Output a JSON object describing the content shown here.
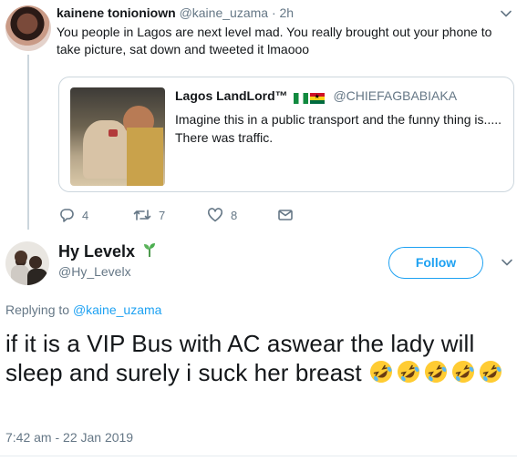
{
  "parent_tweet": {
    "display_name": "kainene tonioniown",
    "handle": "@kaine_uzama",
    "separator": "·",
    "timestamp": "2h",
    "text": "You people in Lagos are next level mad. You really brought out your phone to take picture, sat down and tweeted it lmaooo",
    "quoted_tweet": {
      "display_name": "Lagos LandLord™",
      "flags": [
        "nigeria-flag",
        "ghana-flag"
      ],
      "handle": "@CHIEFAGBABIAKA",
      "text": "Imagine this in a public transport and the funny thing is..... There was traffic."
    },
    "actions": {
      "reply_count": "4",
      "retweet_count": "7",
      "like_count": "8",
      "icons": [
        "reply-icon",
        "retweet-icon",
        "like-icon",
        "message-icon"
      ]
    }
  },
  "reply_tweet": {
    "display_name": "Hy Levelx",
    "handle": "@Hy_Levelx",
    "follow_label": "Follow",
    "replying_prefix": "Replying to",
    "replying_handle": "@kaine_uzama",
    "text": "if it is a VIP Bus with AC aswear the lady will sleep and surely i suck her breast",
    "emoji": [
      "rolling-on-floor-laughing",
      "rolling-on-floor-laughing",
      "rolling-on-floor-laughing",
      "rolling-on-floor-laughing",
      "rolling-on-floor-laughing"
    ],
    "timestamp": "7:42 am - 22 Jan 2019"
  },
  "colors": {
    "accent": "#1da1f2",
    "muted": "#657786",
    "text": "#14171a",
    "border": "#ccd6dd"
  }
}
